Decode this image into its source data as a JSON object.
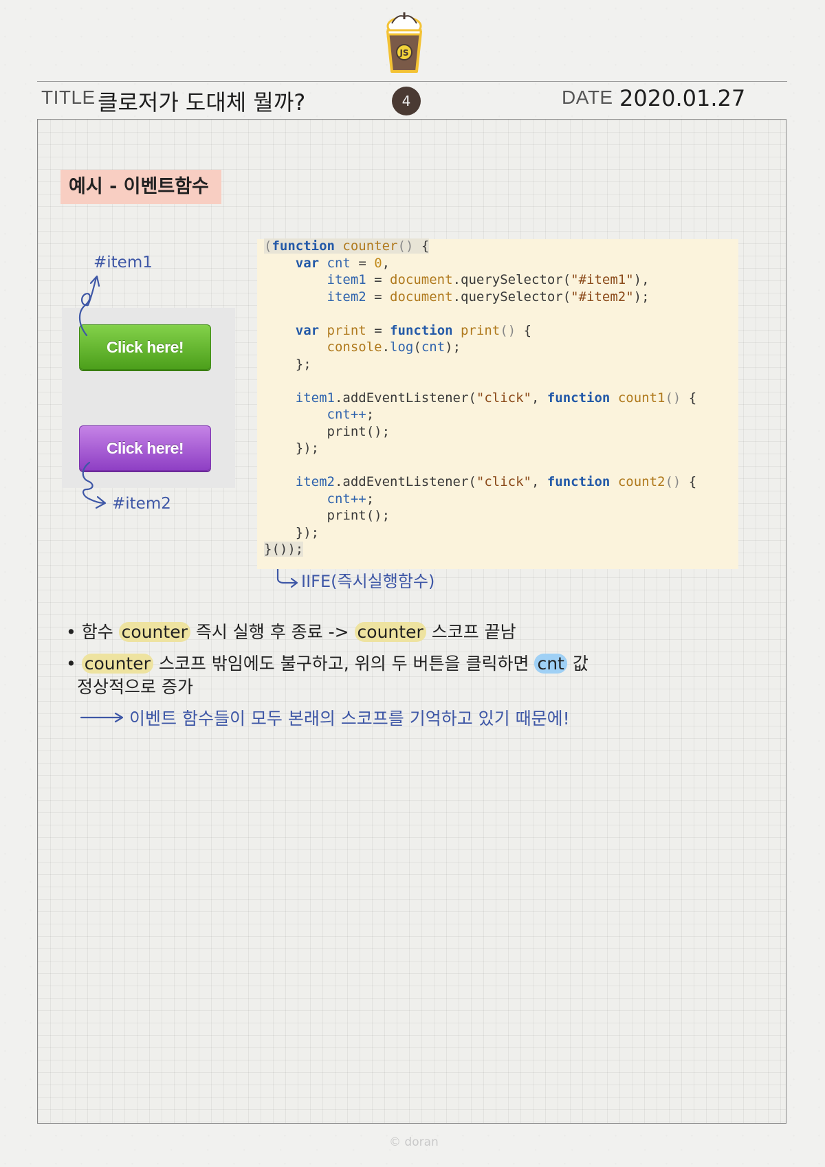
{
  "header": {
    "title_label": "TITLE",
    "title": "클로저가 도대체 뭘까?",
    "page_number": "4",
    "date_label": "DATE",
    "date": "2020.01.27",
    "logo_text": "JS"
  },
  "section": {
    "tag": "예시 - 이벤트함수"
  },
  "demo": {
    "button1_label": "Click here!",
    "button2_label": "Click here!",
    "item1_label": "#item1",
    "item2_label": "#item2",
    "button1_color": "#5cb52a",
    "button2_color": "#a95bd6"
  },
  "code": {
    "lines": [
      "(function counter() {",
      "    var cnt = 0,",
      "        item1 = document.querySelector(\"#item1\"),",
      "        item2 = document.querySelector(\"#item2\");",
      "",
      "    var print = function print() {",
      "        console.log(cnt);",
      "    };",
      "",
      "    item1.addEventListener(\"click\", function count1() {",
      "        cnt++;",
      "        print();",
      "    });",
      "",
      "    item2.addEventListener(\"click\", function count2() {",
      "        cnt++;",
      "        print();",
      "    });",
      "}());"
    ],
    "iife_label": "IIFE(즉시실행함수)"
  },
  "notes": {
    "bullet1": {
      "pre": "함수",
      "word1": "counter",
      "mid": "즉시 실행 후 종료 ->",
      "word2": "counter",
      "post": "스코프 끝남"
    },
    "bullet2": {
      "word1": "counter",
      "mid": "스코프 밖임에도 불구하고, 위의 두 버튼을 클릭하면",
      "word2": "cnt",
      "post": "값",
      "line2": "정상적으로 증가"
    },
    "conclusion": "이벤트 함수들이 모두 본래의 스코프를 기억하고 있기 때문에!"
  },
  "footer": {
    "copyright": "© doran"
  },
  "colors": {
    "accent_blue": "#3e57a6",
    "tag_pink": "#f8cec2",
    "highlight_yellow": "#eee3a0",
    "highlight_blue": "#9fd0f5",
    "code_bg": "#fbf3dc"
  }
}
